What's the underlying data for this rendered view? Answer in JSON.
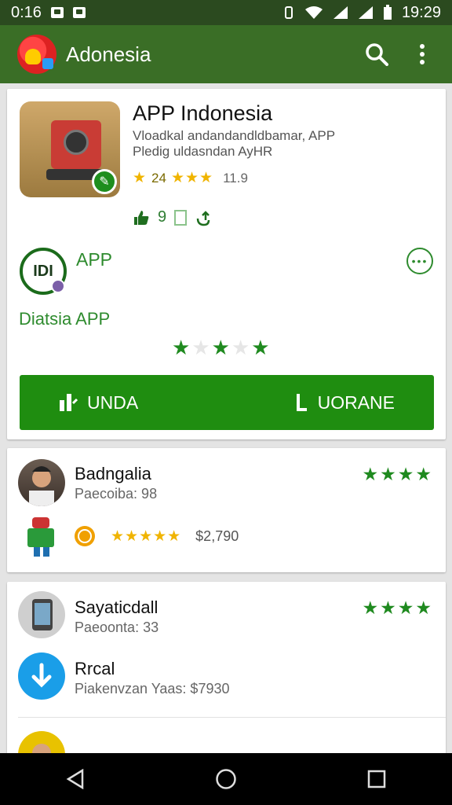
{
  "status": {
    "left_time": "0:16",
    "right_time": "19:29"
  },
  "appbar": {
    "title": "Adonesia"
  },
  "app": {
    "title": "APP Indonesia",
    "desc_line1": "Vloadkal andandandldbamar, APP",
    "desc_line2": "Pledig uldasndan AyHR",
    "rating_value": "24",
    "rating_count": "11.9",
    "meta_value": "9"
  },
  "publisher": {
    "badge_text": "IDI",
    "label": "APP",
    "developer": "Diatsia APP"
  },
  "actions": {
    "left_label": "UNDA",
    "right_label": "UORANE"
  },
  "reviews": [
    {
      "title": "Badngalia",
      "subtitle": "Paecoiba: 98",
      "sub_rating_text": "$2,790"
    }
  ],
  "list": [
    {
      "title": "Sayaticdall",
      "subtitle": "Paeoonta: 33"
    },
    {
      "title": "Rrcal",
      "subtitle": "Piakenvzan Yaas: $7930"
    }
  ],
  "colors": {
    "appbar": "#3a6e26",
    "statusbar": "#2b4a1f",
    "primary_green": "#1f8d10",
    "star_gold": "#f0b400"
  }
}
